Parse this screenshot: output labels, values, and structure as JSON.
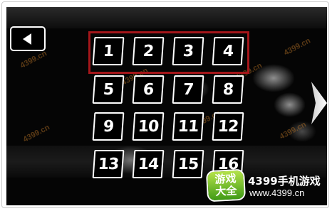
{
  "level_select": {
    "levels": [
      "1",
      "2",
      "3",
      "4",
      "5",
      "6",
      "7",
      "8",
      "9",
      "10",
      "11",
      "12",
      "13",
      "14",
      "15",
      "16"
    ],
    "selected_row": 1
  },
  "navigation": {
    "back_icon": "triangle-left-icon",
    "next_icon": "chevron-right-icon"
  },
  "watermark": {
    "logo_badge_line1": "游戏",
    "logo_badge_line2": "大全",
    "title": "4399手机游戏",
    "url": "www.4399.cn",
    "tiled_text": "4399.cn"
  },
  "colors": {
    "background": "#050505",
    "tile_border": "#ffffff",
    "selection_border": "#a4161a",
    "logo_green": "#5fb51e"
  }
}
